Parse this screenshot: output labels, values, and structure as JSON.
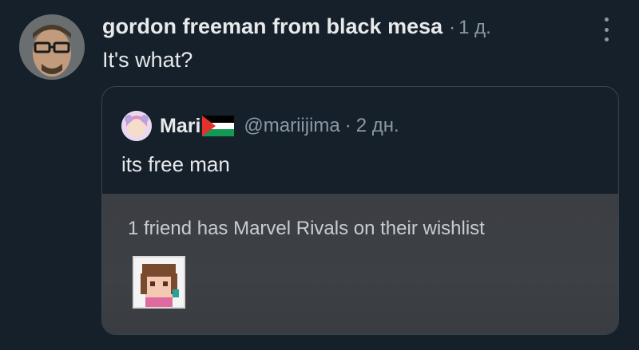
{
  "tweet": {
    "author_name": "gordon freeman from black mesa",
    "separator": "·",
    "time": "1 д.",
    "text": "It's what?",
    "more_icon": "more-vertical-icon"
  },
  "quoted": {
    "author_name": "Mari",
    "flag": "palestine-flag",
    "handle": "@mariijima",
    "separator": "·",
    "time": "2 дн.",
    "text": "its free man",
    "media": {
      "caption": "1 friend has Marvel Rivals on their wishlist"
    }
  },
  "colors": {
    "background": "#15202b",
    "text": "#e7e9ea",
    "muted": "#8b98a5",
    "border": "#38444d"
  }
}
